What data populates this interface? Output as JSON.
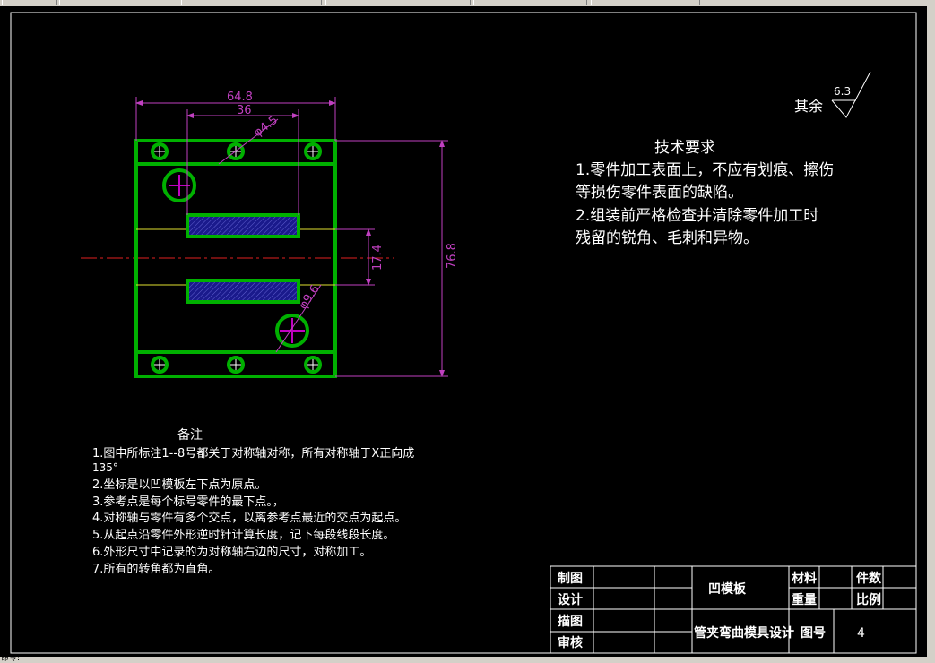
{
  "status": {
    "command_prompt": "命令:"
  },
  "drawing": {
    "dimensions": {
      "overall_width": "64.8",
      "inner_width": "36",
      "small_hole": "φ4.5",
      "slot_spacing": "17.4",
      "overall_height": "76.8",
      "large_hole": "φ9.6"
    },
    "roughness": {
      "prefix": "其余",
      "value": "6.3"
    },
    "tech_requirements": {
      "title": "技术要求",
      "lines": [
        "1.零件加工表面上，不应有划痕、擦伤",
        "等损伤零件表面的缺陷。",
        "2.组装前严格检查并清除零件加工时",
        "残留的锐角、毛刺和异物。"
      ]
    },
    "notes": {
      "title": "备注",
      "lines": [
        "1.图中所标注1--8号都关于对称轴对称，所有对称轴于X正向成",
        "135°",
        "2.坐标是以凹模板左下点为原点。",
        "3.参考点是每个标号零件的最下点。，",
        "4.对称轴与零件有多个交点，以离参考点最近的交点为起点。",
        "5.从起点沿零件外形逆时针计算长度，记下每段线段长度。",
        "6.外形尺寸中记录的为对称轴右边的尺寸，对称加工。",
        "7.所有的转角都为直角。"
      ]
    },
    "title_block": {
      "row_labels": [
        "制图",
        "设计",
        "描图",
        "审核"
      ],
      "part_name": "凹模板",
      "material_label": "材料",
      "quantity_label": "件数",
      "weight_label": "重量",
      "scale_label": "比例",
      "project_name": "管夹弯曲模具设计",
      "drawing_no_label": "图号",
      "drawing_no": "4"
    }
  },
  "colors": {
    "part_outline": "#00b000",
    "dimension": "#c040c0",
    "centerline": "#e02020",
    "hatch": "#1a1a8c",
    "guide_line": "#e0e030",
    "text": "#ffffff"
  }
}
